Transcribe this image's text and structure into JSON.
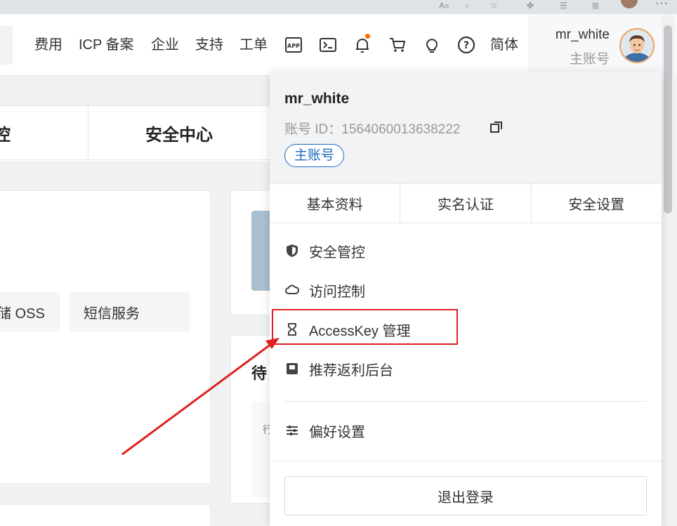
{
  "header": {
    "nav": [
      "费用",
      "ICP 备案",
      "企业",
      "支持",
      "工单"
    ],
    "language": "简体",
    "user": {
      "name": "mr_white",
      "role": "主账号"
    },
    "icons": [
      "app-icon",
      "terminal-icon",
      "bell-icon",
      "cart-icon",
      "lightbulb-icon",
      "help-icon"
    ]
  },
  "background": {
    "tabs": [
      "控",
      "安全中心"
    ],
    "chips": [
      "储 OSS",
      "短信服务"
    ],
    "side_text": "待",
    "side_small": "行"
  },
  "dropdown": {
    "name": "mr_white",
    "id_label": "账号 ID：",
    "id_value": "1564060013638222",
    "role_badge": "主账号",
    "tabs": [
      "基本资料",
      "实名认证",
      "安全设置"
    ],
    "menu": [
      {
        "label": "安全管控",
        "icon": "shield-icon"
      },
      {
        "label": "访问控制",
        "icon": "cloud-icon"
      },
      {
        "label": "AccessKey 管理",
        "icon": "key-icon"
      },
      {
        "label": "推荐返利后台",
        "icon": "rebate-icon"
      },
      {
        "label": "偏好设置",
        "icon": "sliders-icon"
      }
    ],
    "logout": "退出登录"
  },
  "annotation": {
    "color": "#e02020",
    "target": "AccessKey 管理"
  },
  "colors": {
    "accent": "#1a69c4",
    "notify": "#ff6a00",
    "annotation": "#e02020"
  }
}
